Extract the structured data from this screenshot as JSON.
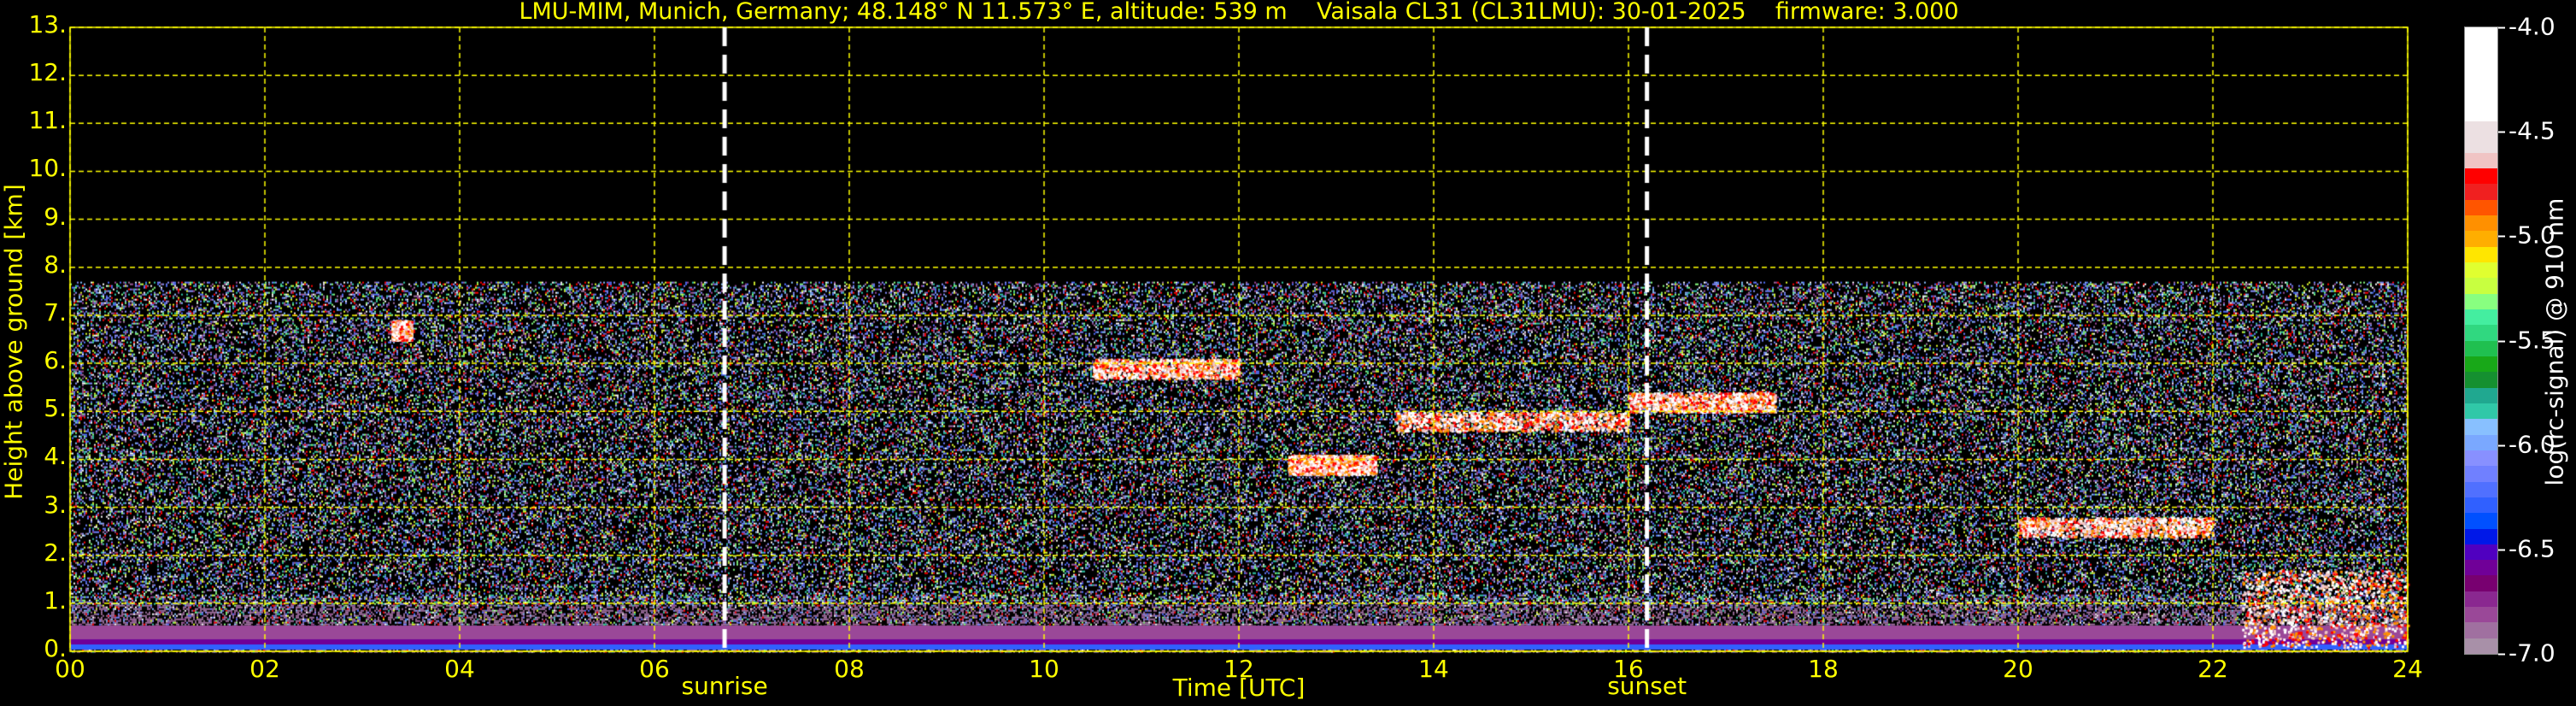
{
  "chart_data": {
    "type": "heatmap",
    "title": "LMU-MIM, Munich, Germany; 48.148° N 11.573° E, altitude: 539 m    Vaisala CL31 (CL31LMU): 30-01-2025    firmware: 3.000",
    "xlabel": "Time [UTC]",
    "ylabel": "Height above ground [km]",
    "xlim": [
      0,
      24
    ],
    "ylim": [
      0,
      13
    ],
    "x_ticks": [
      "00",
      "02",
      "04",
      "06",
      "08",
      "10",
      "12",
      "14",
      "16",
      "18",
      "20",
      "22",
      "24"
    ],
    "y_ticks": [
      "0.",
      "1.",
      "2.",
      "3.",
      "4.",
      "5.",
      "6.",
      "7.",
      "8.",
      "9.",
      "10.",
      "11.",
      "12.",
      "13."
    ],
    "grid": true,
    "data_max_height_km": 7.7,
    "events": [
      {
        "label": "sunrise",
        "time_utc": 6.72
      },
      {
        "label": "sunset",
        "time_utc": 16.19
      }
    ],
    "cloud_features": [
      {
        "t_start": 3.3,
        "t_end": 3.5,
        "height_km": 6.7
      },
      {
        "t_start": 10.5,
        "t_end": 12.0,
        "height_km": 5.9
      },
      {
        "t_start": 12.5,
        "t_end": 13.4,
        "height_km": 3.9
      },
      {
        "t_start": 13.6,
        "t_end": 16.0,
        "height_km": 4.8
      },
      {
        "t_start": 16.0,
        "t_end": 17.5,
        "height_km": 5.2
      },
      {
        "t_start": 20.0,
        "t_end": 22.0,
        "height_km": 2.6
      },
      {
        "t_start": 22.3,
        "t_end": 24.0,
        "height_km": 0.9
      }
    ],
    "colorbar": {
      "label": "log(rc-signal) @ 910 nm",
      "range": [
        -7.0,
        -4.0
      ],
      "ticks": [
        "-4.0",
        "-4.5",
        "-5.0",
        "-5.5",
        "-6.0",
        "-6.5",
        "-7.0"
      ],
      "colors_top_to_bottom": [
        "#ffffff",
        "#ffffff",
        "#ffffff",
        "#ffffff",
        "#ffffff",
        "#ffffff",
        "#ece0e2",
        "#ece0e2",
        "#f0c4c4",
        "#ff0000",
        "#f02020",
        "#ff5500",
        "#ff9000",
        "#ffae00",
        "#ffe600",
        "#e0ff30",
        "#c8ff40",
        "#88ff80",
        "#44eea0",
        "#30d880",
        "#20c050",
        "#18a818",
        "#159030",
        "#20a890",
        "#30c8a8",
        "#88c0ff",
        "#7aa8ff",
        "#8890ff",
        "#7080ff",
        "#5070ff",
        "#3060ff",
        "#0050ff",
        "#0018e8",
        "#5000c0",
        "#700098",
        "#780070",
        "#8a2890",
        "#9a4898",
        "#a070a0",
        "#a890a8"
      ]
    }
  }
}
